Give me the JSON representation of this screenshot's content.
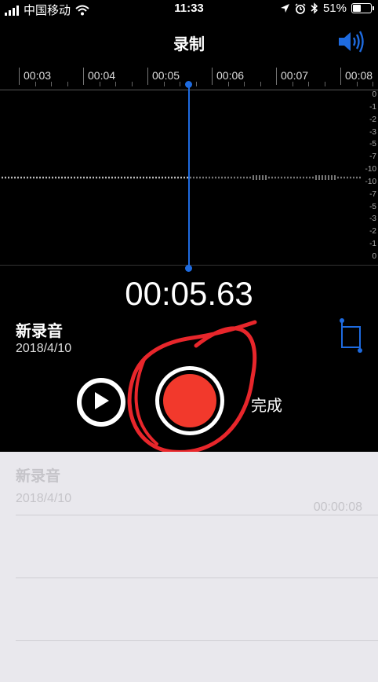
{
  "status": {
    "carrier": "中国移动",
    "time": "11:33",
    "battery": "51%",
    "battery_level": 0.51
  },
  "nav": {
    "title": "录制"
  },
  "timeline": {
    "labels": [
      "00:03",
      "00:04",
      "00:05",
      "00:06",
      "00:07",
      "00:08"
    ]
  },
  "waveform": {
    "db_scale": [
      "0",
      "-1",
      "-2",
      "-3",
      "-5",
      "-7",
      "-10",
      "-10",
      "-7",
      "-5",
      "-3",
      "-2",
      "-1",
      "0"
    ]
  },
  "recorder": {
    "elapsed": "00:05.63",
    "name": "新录音",
    "date": "2018/4/10",
    "done_label": "完成"
  },
  "list": {
    "items": [
      {
        "name": "新录音",
        "date": "2018/4/10",
        "duration": "00:00:08"
      }
    ]
  },
  "colors": {
    "accent": "#1e6be0",
    "record": "#f2392c",
    "annotation": "#e8262b"
  },
  "icons": [
    "wifi-icon",
    "location-icon",
    "alarm-icon",
    "bluetooth-icon",
    "speaker-icon",
    "crop-icon",
    "play-icon",
    "record-icon"
  ]
}
